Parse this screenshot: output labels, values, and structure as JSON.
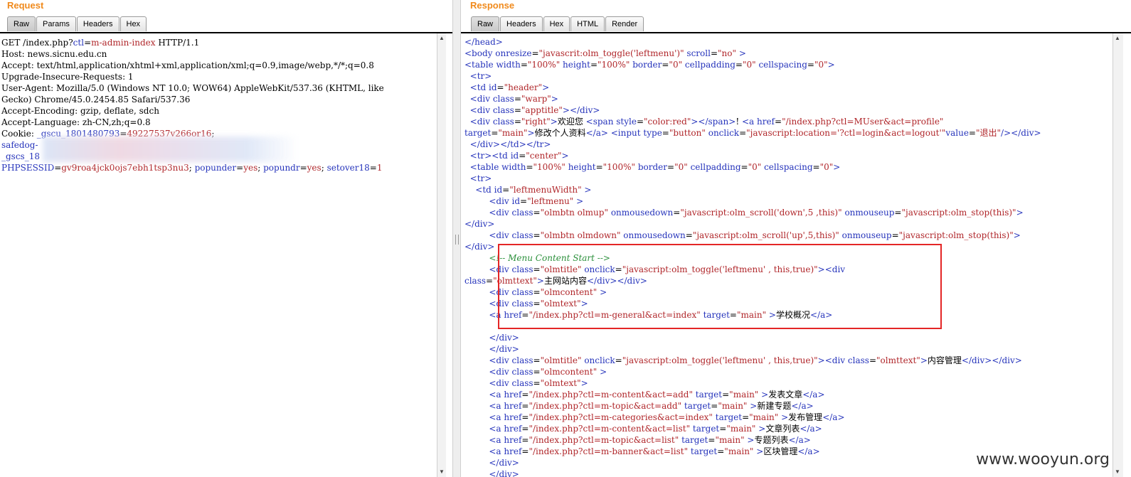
{
  "request": {
    "title": "Request",
    "tabs": [
      "Raw",
      "Params",
      "Headers",
      "Hex"
    ],
    "lines": [
      [
        [
          "t",
          "GET /index.php?"
        ],
        [
          "k",
          "ctl"
        ],
        [
          "t",
          "="
        ],
        [
          "v",
          "m-admin-index"
        ],
        [
          "t",
          " HTTP/1.1"
        ]
      ],
      [
        [
          "t",
          "Host: news.sicnu.edu.cn"
        ]
      ],
      [
        [
          "t",
          "Accept: text/html,application/xhtml+xml,application/xml;q=0.9,image/webp,*/*;q=0.8"
        ]
      ],
      [
        [
          "t",
          "Upgrade-Insecure-Requests: 1"
        ]
      ],
      [
        [
          "t",
          "User-Agent: Mozilla/5.0 (Windows NT 10.0; WOW64) AppleWebKit/537.36 (KHTML, like"
        ]
      ],
      [
        [
          "t",
          "Gecko) Chrome/45.0.2454.85 Safari/537.36"
        ]
      ],
      [
        [
          "t",
          "Accept-Encoding: gzip, deflate, sdch"
        ]
      ],
      [
        [
          "t",
          "Accept-Language: zh-CN,zh;q=0.8"
        ]
      ],
      [
        [
          "t",
          "Cookie: "
        ],
        [
          "k",
          "_gscu_1801480793"
        ],
        [
          "t",
          "="
        ],
        [
          "v",
          "49227537v266or16"
        ],
        [
          "t",
          ";"
        ]
      ],
      [
        [
          "k",
          "safedog-"
        ]
      ],
      [
        [
          "k",
          "_gscs_18"
        ]
      ],
      [
        [
          "k",
          "PHPSESSID"
        ],
        [
          "t",
          "="
        ],
        [
          "v",
          "gv9roa4jck0ojs7ebh1tsp3nu3"
        ],
        [
          "t",
          "; "
        ],
        [
          "k",
          "popunder"
        ],
        [
          "t",
          "="
        ],
        [
          "v",
          "yes"
        ],
        [
          "t",
          "; "
        ],
        [
          "k",
          "popundr"
        ],
        [
          "t",
          "="
        ],
        [
          "v",
          "yes"
        ],
        [
          "t",
          "; "
        ],
        [
          "k",
          "setover18"
        ],
        [
          "t",
          "="
        ],
        [
          "v",
          "1"
        ]
      ]
    ]
  },
  "response": {
    "title": "Response",
    "tabs": [
      "Raw",
      "Headers",
      "Hex",
      "HTML",
      "Render"
    ],
    "lines": [
      [
        [
          "k",
          "</head>"
        ]
      ],
      [
        [
          "k",
          "<body "
        ],
        [
          "k",
          "onresize"
        ],
        [
          "t",
          "="
        ],
        [
          "v",
          "\"javascrit:olm_toggle('leftmenu')\""
        ],
        [
          "k",
          " scroll"
        ],
        [
          "t",
          "="
        ],
        [
          "v",
          "\"no\""
        ],
        [
          "k",
          " >"
        ]
      ],
      [
        [
          "k",
          "<table "
        ],
        [
          "k",
          "width"
        ],
        [
          "t",
          "="
        ],
        [
          "v",
          "\"100%\""
        ],
        [
          "k",
          " height"
        ],
        [
          "t",
          "="
        ],
        [
          "v",
          "\"100%\""
        ],
        [
          "k",
          " border"
        ],
        [
          "t",
          "="
        ],
        [
          "v",
          "\"0\""
        ],
        [
          "k",
          " cellpadding"
        ],
        [
          "t",
          "="
        ],
        [
          "v",
          "\"0\""
        ],
        [
          "k",
          " cellspacing"
        ],
        [
          "t",
          "="
        ],
        [
          "v",
          "\"0\""
        ],
        [
          "k",
          ">"
        ]
      ],
      [
        [
          "t",
          "  "
        ],
        [
          "k",
          "<tr>"
        ]
      ],
      [
        [
          "t",
          "  "
        ],
        [
          "k",
          "<td "
        ],
        [
          "k",
          "id"
        ],
        [
          "t",
          "="
        ],
        [
          "v",
          "\"header\""
        ],
        [
          "k",
          ">"
        ]
      ],
      [
        [
          "t",
          "  "
        ],
        [
          "k",
          "<div "
        ],
        [
          "k",
          "class"
        ],
        [
          "t",
          "="
        ],
        [
          "v",
          "\"warp\""
        ],
        [
          "k",
          ">"
        ]
      ],
      [
        [
          "t",
          "  "
        ],
        [
          "k",
          "<div "
        ],
        [
          "k",
          "class"
        ],
        [
          "t",
          "="
        ],
        [
          "v",
          "\"apptitle\""
        ],
        [
          "k",
          "></div>"
        ]
      ],
      [
        [
          "t",
          "  "
        ],
        [
          "k",
          "<div "
        ],
        [
          "k",
          "class"
        ],
        [
          "t",
          "="
        ],
        [
          "v",
          "\"right\""
        ],
        [
          "k",
          ">"
        ],
        [
          "t",
          "欢迎您 "
        ],
        [
          "k",
          "<span "
        ],
        [
          "k",
          "style"
        ],
        [
          "t",
          "="
        ],
        [
          "v",
          "\"color:red\""
        ],
        [
          "k",
          "></span>"
        ],
        [
          "t",
          "! "
        ],
        [
          "k",
          "<a "
        ],
        [
          "k",
          "href"
        ],
        [
          "t",
          "="
        ],
        [
          "v",
          "\"/index.php?ctl=MUser&act=profile\""
        ]
      ],
      [
        [
          "k",
          "target"
        ],
        [
          "t",
          "="
        ],
        [
          "v",
          "\"main\""
        ],
        [
          "k",
          ">"
        ],
        [
          "t",
          "修改个人资料"
        ],
        [
          "k",
          "</a> <input "
        ],
        [
          "k",
          "type"
        ],
        [
          "t",
          "="
        ],
        [
          "v",
          "\"button\""
        ],
        [
          "k",
          " onclick"
        ],
        [
          "t",
          "="
        ],
        [
          "v",
          "\"javascript:location='?ctl=login&act=logout'\""
        ],
        [
          "k",
          "value"
        ],
        [
          "t",
          "="
        ],
        [
          "v",
          "\"退出\""
        ],
        [
          "k",
          "/></div>"
        ]
      ],
      [
        [
          "t",
          "  "
        ],
        [
          "k",
          "</div></td></tr>"
        ]
      ],
      [
        [
          "t",
          "  "
        ],
        [
          "k",
          "<tr><td "
        ],
        [
          "k",
          "id"
        ],
        [
          "t",
          "="
        ],
        [
          "v",
          "\"center\""
        ],
        [
          "k",
          ">"
        ]
      ],
      [
        [
          "t",
          "  "
        ],
        [
          "k",
          "<table "
        ],
        [
          "k",
          "width"
        ],
        [
          "t",
          "="
        ],
        [
          "v",
          "\"100%\""
        ],
        [
          "k",
          " height"
        ],
        [
          "t",
          "="
        ],
        [
          "v",
          "\"100%\""
        ],
        [
          "k",
          " border"
        ],
        [
          "t",
          "="
        ],
        [
          "v",
          "\"0\""
        ],
        [
          "k",
          " cellpadding"
        ],
        [
          "t",
          "="
        ],
        [
          "v",
          "\"0\""
        ],
        [
          "k",
          " cellspacing"
        ],
        [
          "t",
          "="
        ],
        [
          "v",
          "\"0\""
        ],
        [
          "k",
          ">"
        ]
      ],
      [
        [
          "t",
          "  "
        ],
        [
          "k",
          "<tr>"
        ]
      ],
      [
        [
          "t",
          "    "
        ],
        [
          "k",
          "<td "
        ],
        [
          "k",
          "id"
        ],
        [
          "t",
          "="
        ],
        [
          "v",
          "\"leftmenuWidth\""
        ],
        [
          "k",
          " >"
        ]
      ],
      [
        [
          "t",
          "         "
        ],
        [
          "k",
          "<div "
        ],
        [
          "k",
          "id"
        ],
        [
          "t",
          "="
        ],
        [
          "v",
          "\"leftmenu\""
        ],
        [
          "k",
          " >"
        ]
      ],
      [
        [
          "t",
          "         "
        ],
        [
          "k",
          "<div "
        ],
        [
          "k",
          "class"
        ],
        [
          "t",
          "="
        ],
        [
          "v",
          "\"olmbtn olmup\""
        ],
        [
          "k",
          " onmousedown"
        ],
        [
          "t",
          "="
        ],
        [
          "v",
          "\"javascript:olm_scroll('down',5 ,this)\""
        ],
        [
          "k",
          " onmouseup"
        ],
        [
          "t",
          "="
        ],
        [
          "v",
          "\"javascript:olm_stop(this)\""
        ],
        [
          "k",
          ">"
        ]
      ],
      [
        [
          "k",
          "</div>"
        ]
      ],
      [
        [
          "t",
          "         "
        ],
        [
          "k",
          "<div "
        ],
        [
          "k",
          "class"
        ],
        [
          "t",
          "="
        ],
        [
          "v",
          "\"olmbtn olmdown\""
        ],
        [
          "k",
          " onmousedown"
        ],
        [
          "t",
          "="
        ],
        [
          "v",
          "\"javascript:olm_scroll('up',5,this)\""
        ],
        [
          "k",
          " onmouseup"
        ],
        [
          "t",
          "="
        ],
        [
          "v",
          "\"javascript:olm_stop(this)\""
        ],
        [
          "k",
          ">"
        ]
      ],
      [
        [
          "k",
          "</div>"
        ]
      ],
      [
        [
          "t",
          "         "
        ],
        [
          "c",
          "<!-- Menu Content Start -->"
        ]
      ],
      [
        [
          "t",
          "         "
        ],
        [
          "k",
          "<div "
        ],
        [
          "k",
          "class"
        ],
        [
          "t",
          "="
        ],
        [
          "v",
          "\"olmtitle\""
        ],
        [
          "k",
          " onclick"
        ],
        [
          "t",
          "="
        ],
        [
          "v",
          "\"javascript:olm_toggle('leftmenu' , this,true)\""
        ],
        [
          "k",
          "><div"
        ]
      ],
      [
        [
          "k",
          "class"
        ],
        [
          "t",
          "="
        ],
        [
          "v",
          "\"olmttext\""
        ],
        [
          "k",
          ">"
        ],
        [
          "t",
          "主网站内容"
        ],
        [
          "k",
          "</div></div>"
        ]
      ],
      [
        [
          "t",
          "         "
        ],
        [
          "k",
          "<div "
        ],
        [
          "k",
          "class"
        ],
        [
          "t",
          "="
        ],
        [
          "v",
          "\"olmcontent\""
        ],
        [
          "k",
          " >"
        ]
      ],
      [
        [
          "t",
          "         "
        ],
        [
          "k",
          "<div "
        ],
        [
          "k",
          "class"
        ],
        [
          "t",
          "="
        ],
        [
          "v",
          "\"olmtext\""
        ],
        [
          "k",
          ">"
        ]
      ],
      [
        [
          "t",
          "         "
        ],
        [
          "k",
          "<a "
        ],
        [
          "k",
          "href"
        ],
        [
          "t",
          "="
        ],
        [
          "v",
          "\"/index.php?ctl=m-general&act=index\""
        ],
        [
          "k",
          " target"
        ],
        [
          "t",
          "="
        ],
        [
          "v",
          "\"main\""
        ],
        [
          "k",
          " >"
        ],
        [
          "t",
          "学校概况"
        ],
        [
          "k",
          "</a>"
        ]
      ],
      [
        [
          "t",
          ""
        ]
      ],
      [
        [
          "t",
          "         "
        ],
        [
          "k",
          "</div>"
        ]
      ],
      [
        [
          "t",
          "         "
        ],
        [
          "k",
          "</div>"
        ]
      ],
      [
        [
          "t",
          "         "
        ],
        [
          "k",
          "<div "
        ],
        [
          "k",
          "class"
        ],
        [
          "t",
          "="
        ],
        [
          "v",
          "\"olmtitle\""
        ],
        [
          "k",
          " onclick"
        ],
        [
          "t",
          "="
        ],
        [
          "v",
          "\"javascript:olm_toggle('leftmenu' , this,true)\""
        ],
        [
          "k",
          "><div "
        ],
        [
          "k",
          "class"
        ],
        [
          "t",
          "="
        ],
        [
          "v",
          "\"olmttext\""
        ],
        [
          "k",
          ">"
        ],
        [
          "t",
          "内容管理"
        ],
        [
          "k",
          "</div></div>"
        ]
      ],
      [
        [
          "t",
          "         "
        ],
        [
          "k",
          "<div "
        ],
        [
          "k",
          "class"
        ],
        [
          "t",
          "="
        ],
        [
          "v",
          "\"olmcontent\""
        ],
        [
          "k",
          " >"
        ]
      ],
      [
        [
          "t",
          "         "
        ],
        [
          "k",
          "<div "
        ],
        [
          "k",
          "class"
        ],
        [
          "t",
          "="
        ],
        [
          "v",
          "\"olmtext\""
        ],
        [
          "k",
          ">"
        ]
      ],
      [
        [
          "t",
          "         "
        ],
        [
          "k",
          "<a "
        ],
        [
          "k",
          "href"
        ],
        [
          "t",
          "="
        ],
        [
          "v",
          "\"/index.php?ctl=m-content&act=add\""
        ],
        [
          "k",
          " target"
        ],
        [
          "t",
          "="
        ],
        [
          "v",
          "\"main\""
        ],
        [
          "k",
          " >"
        ],
        [
          "t",
          "发表文章"
        ],
        [
          "k",
          "</a>"
        ]
      ],
      [
        [
          "t",
          "         "
        ],
        [
          "k",
          "<a "
        ],
        [
          "k",
          "href"
        ],
        [
          "t",
          "="
        ],
        [
          "v",
          "\"/index.php?ctl=m-topic&act=add\""
        ],
        [
          "k",
          " target"
        ],
        [
          "t",
          "="
        ],
        [
          "v",
          "\"main\""
        ],
        [
          "k",
          " >"
        ],
        [
          "t",
          "新建专题"
        ],
        [
          "k",
          "</a>"
        ]
      ],
      [
        [
          "t",
          "         "
        ],
        [
          "k",
          "<a "
        ],
        [
          "k",
          "href"
        ],
        [
          "t",
          "="
        ],
        [
          "v",
          "\"/index.php?ctl=m-categories&act=index\""
        ],
        [
          "k",
          " target"
        ],
        [
          "t",
          "="
        ],
        [
          "v",
          "\"main\""
        ],
        [
          "k",
          " >"
        ],
        [
          "t",
          "发布管理"
        ],
        [
          "k",
          "</a>"
        ]
      ],
      [
        [
          "t",
          "         "
        ],
        [
          "k",
          "<a "
        ],
        [
          "k",
          "href"
        ],
        [
          "t",
          "="
        ],
        [
          "v",
          "\"/index.php?ctl=m-content&act=list\""
        ],
        [
          "k",
          " target"
        ],
        [
          "t",
          "="
        ],
        [
          "v",
          "\"main\""
        ],
        [
          "k",
          " >"
        ],
        [
          "t",
          "文章列表"
        ],
        [
          "k",
          "</a>"
        ]
      ],
      [
        [
          "t",
          "         "
        ],
        [
          "k",
          "<a "
        ],
        [
          "k",
          "href"
        ],
        [
          "t",
          "="
        ],
        [
          "v",
          "\"/index.php?ctl=m-topic&act=list\""
        ],
        [
          "k",
          " target"
        ],
        [
          "t",
          "="
        ],
        [
          "v",
          "\"main\""
        ],
        [
          "k",
          " >"
        ],
        [
          "t",
          "专题列表"
        ],
        [
          "k",
          "</a>"
        ]
      ],
      [
        [
          "t",
          "         "
        ],
        [
          "k",
          "<a "
        ],
        [
          "k",
          "href"
        ],
        [
          "t",
          "="
        ],
        [
          "v",
          "\"/index.php?ctl=m-banner&act=list\""
        ],
        [
          "k",
          " target"
        ],
        [
          "t",
          "="
        ],
        [
          "v",
          "\"main\""
        ],
        [
          "k",
          " >"
        ],
        [
          "t",
          "区块管理"
        ],
        [
          "k",
          "</a>"
        ]
      ],
      [
        [
          "t",
          "         "
        ],
        [
          "k",
          "</div>"
        ]
      ],
      [
        [
          "t",
          "         "
        ],
        [
          "k",
          "</div>"
        ]
      ]
    ]
  },
  "watermark": "www.wooyun.org",
  "colors": {
    "title": "#f08a1c",
    "key": "#2533bb",
    "value": "#b0262a",
    "comment": "#2a8f3a",
    "highlight": "#e42626"
  },
  "icons": {
    "scroll_up": "scroll-up-arrow-icon",
    "scroll_down": "scroll-down-arrow-icon"
  }
}
